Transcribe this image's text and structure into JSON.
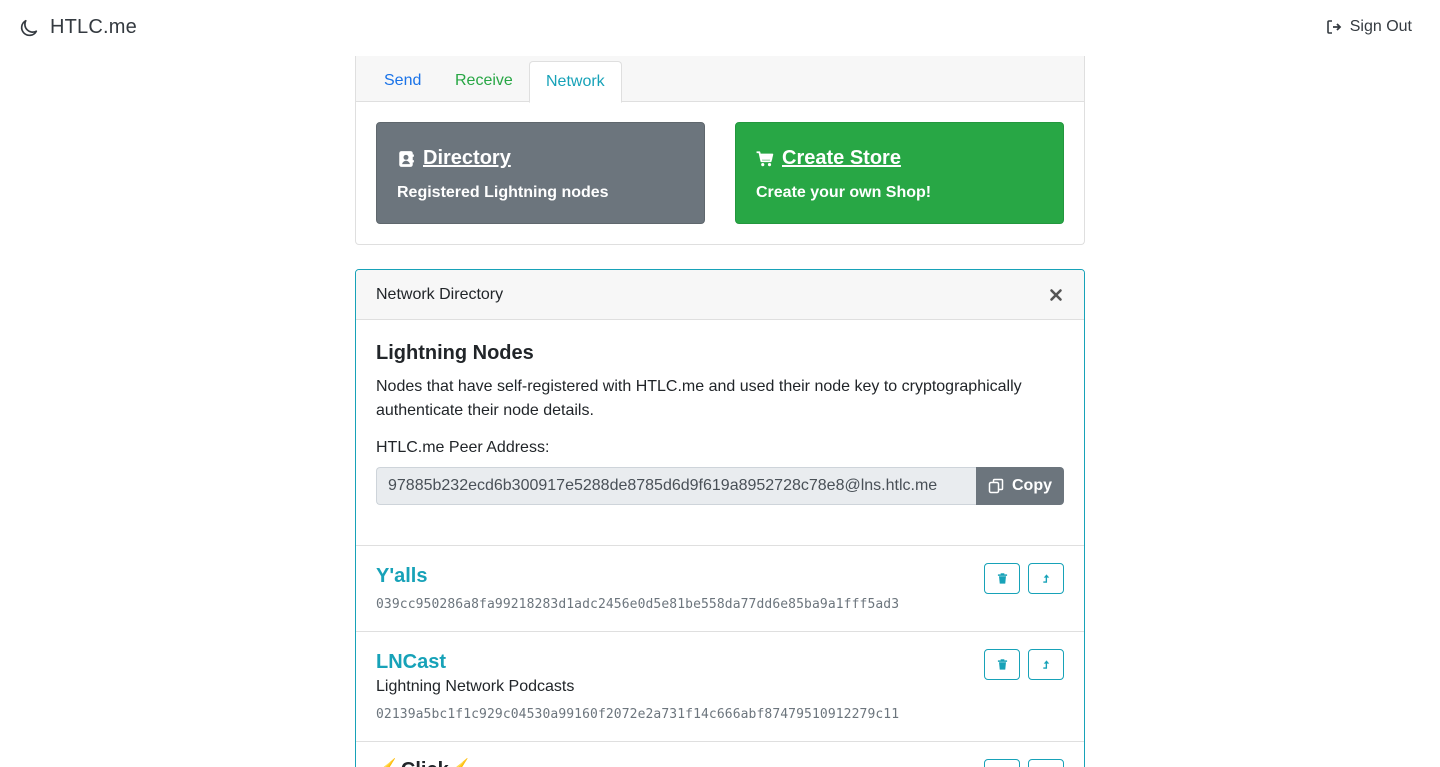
{
  "navbar": {
    "brand": "HTLC.me",
    "brand_icon": "moon-icon",
    "signout_label": "Sign Out",
    "signout_icon": "sign-out-icon"
  },
  "tabs": [
    {
      "label": "Send",
      "color": "#1a73e8"
    },
    {
      "label": "Receive",
      "color": "#28a745"
    },
    {
      "label": "Network",
      "color": "#17a2b8",
      "active": true
    }
  ],
  "tiles": {
    "directory": {
      "title": "Directory",
      "description": "Registered Lightning nodes",
      "icon": "address-book-icon",
      "color": "#6c757d"
    },
    "store": {
      "title": "Create Store",
      "description": "Create your own Shop!",
      "icon": "shopping-cart-icon",
      "color": "#28a745"
    }
  },
  "directory_card": {
    "header": "Network Directory",
    "heading": "Lightning Nodes",
    "description": "Nodes that have self-registered with HTLC.me and used their node key to cryptographically authenticate their node details.",
    "peer_label": "HTLC.me Peer Address:",
    "peer_address": "97885b232ecd6b300917e5288de8785d6d9f619a8952728c78e8@lns.htlc.me",
    "copy_label": "Copy",
    "accent": "#17a2b8"
  },
  "nodes": [
    {
      "name": "Y'alls",
      "description": "",
      "key": "039cc950286a8fa99218283d1adc2456e0d5e81be558da77dd6e85ba9a1fff5ad3"
    },
    {
      "name": "LNCast",
      "description": "Lightning Network Podcasts",
      "key": "02139a5bc1f1c929c04530a99160f2072e2a731f14c666abf87479510912279c11"
    },
    {
      "name": "⚡️Click⚡️",
      "description": "",
      "key": ""
    }
  ]
}
